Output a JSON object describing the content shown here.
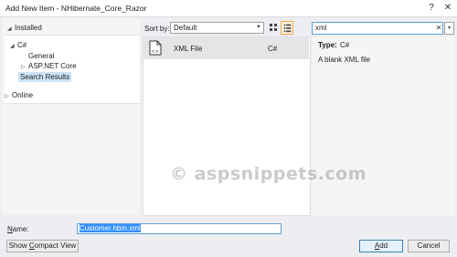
{
  "window": {
    "title": "Add New Item - NHibernate_Core_Razor",
    "help_glyph": "?",
    "close_glyph": "✕"
  },
  "sidebar": {
    "header": "Installed",
    "items": [
      {
        "label": "C#"
      },
      {
        "label": "General"
      },
      {
        "label": "ASP.NET Core"
      },
      {
        "label": "Search Results",
        "selected": true
      }
    ],
    "online": "Online"
  },
  "toolbar": {
    "sort_label": "Sort by:",
    "sort_value": "Default",
    "view_grid_icon": "grid-view-icon",
    "view_list_icon": "list-view-icon"
  },
  "search": {
    "value": "xml",
    "clear_glyph": "✕",
    "dropdown_glyph": "▾"
  },
  "templates": [
    {
      "name": "XML File",
      "language": "C#",
      "icon": "xml-file-icon"
    }
  ],
  "details": {
    "type_label": "Type:",
    "type_value": "C#",
    "description": "A blank XML file"
  },
  "footer": {
    "name_label_prefix": "N",
    "name_label_rest": "ame:",
    "name_value": "Customer.hbm.xml",
    "compact_prefix": "Show ",
    "compact_underline": "C",
    "compact_rest": "ompact View",
    "add_underline": "A",
    "add_rest": "dd",
    "cancel_label": "Cancel"
  },
  "watermark": "© aspsnippets.com",
  "colors": {
    "selection": "#cce4f7",
    "focus_border": "#5ea2d9",
    "text_selection": "#3390ff"
  }
}
